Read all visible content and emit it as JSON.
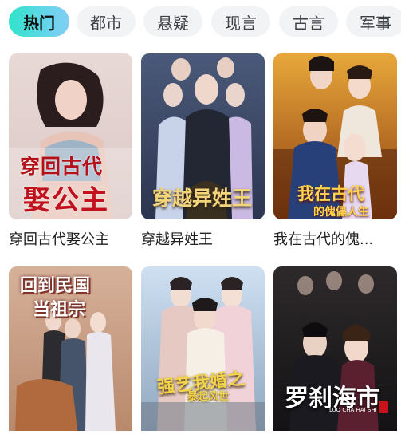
{
  "tabs": [
    "热门",
    "都市",
    "悬疑",
    "现言",
    "古言",
    "军事"
  ],
  "active_tab": 0,
  "cards": [
    {
      "title": "穿回古代娶公主",
      "poster_text": [
        "穿回古代",
        "娶公主"
      ]
    },
    {
      "title": "穿越异姓王",
      "poster_text": [
        "穿越异姓王"
      ]
    },
    {
      "title": "我在古代的傀...",
      "poster_text": [
        "我在古代",
        "的傀儡人生"
      ]
    },
    {
      "title": "",
      "poster_text": [
        "回到民国",
        "当祖宗"
      ]
    },
    {
      "title": "",
      "poster_text": [
        "强艺我婚之",
        "暴起风世"
      ]
    },
    {
      "title": "",
      "poster_text": [
        "罗刹海市",
        "LUO CHA HAI SHI"
      ]
    }
  ],
  "colors": {
    "tab_active_start": "#2fe3c9",
    "tab_active_end": "#84cdf5",
    "tab_bg": "#f2f3f5"
  }
}
